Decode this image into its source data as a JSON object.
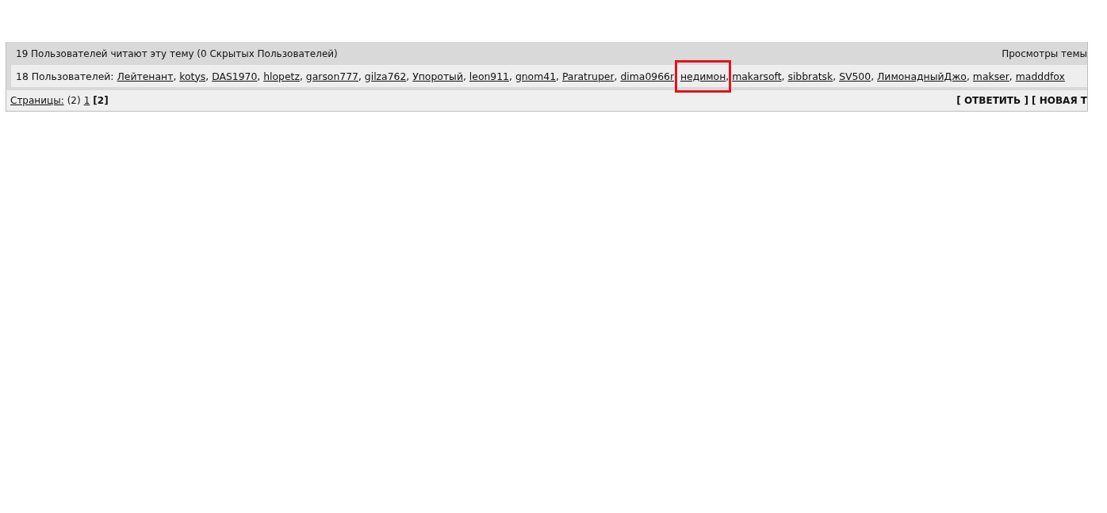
{
  "readers": {
    "title": "19 Пользователей читают эту тему (0 Скрытых Пользователей)",
    "views_label": "Просмотры темы",
    "users_label": "18 Пользователей:",
    "separator": ", ",
    "users": [
      {
        "name": "Лейтенант",
        "highlighted": false
      },
      {
        "name": "kotys",
        "highlighted": false
      },
      {
        "name": "DAS1970",
        "highlighted": false
      },
      {
        "name": "hlopetz",
        "highlighted": false
      },
      {
        "name": "garson777",
        "highlighted": false
      },
      {
        "name": "gilza762",
        "highlighted": false
      },
      {
        "name": "Упоротый",
        "highlighted": false
      },
      {
        "name": "leon911",
        "highlighted": false
      },
      {
        "name": "gnom41",
        "highlighted": false
      },
      {
        "name": "Paratruper",
        "highlighted": false
      },
      {
        "name": "dima0966r",
        "highlighted": false
      },
      {
        "name": "недимон",
        "highlighted": true
      },
      {
        "name": "makarsoft",
        "highlighted": false
      },
      {
        "name": "sibbratsk",
        "highlighted": false
      },
      {
        "name": "SV500",
        "highlighted": false
      },
      {
        "name": "ЛимонадныйДжо",
        "highlighted": false
      },
      {
        "name": "makser",
        "highlighted": false
      },
      {
        "name": "madddfox",
        "highlighted": false
      }
    ]
  },
  "pagination": {
    "label": "Страницы:",
    "count": "(2)",
    "pages": [
      {
        "label": "1",
        "selected": false
      },
      {
        "label": "[2]",
        "selected": true
      }
    ],
    "actions": "[ ОТВЕТИТЬ ] [ НОВАЯ Т"
  }
}
